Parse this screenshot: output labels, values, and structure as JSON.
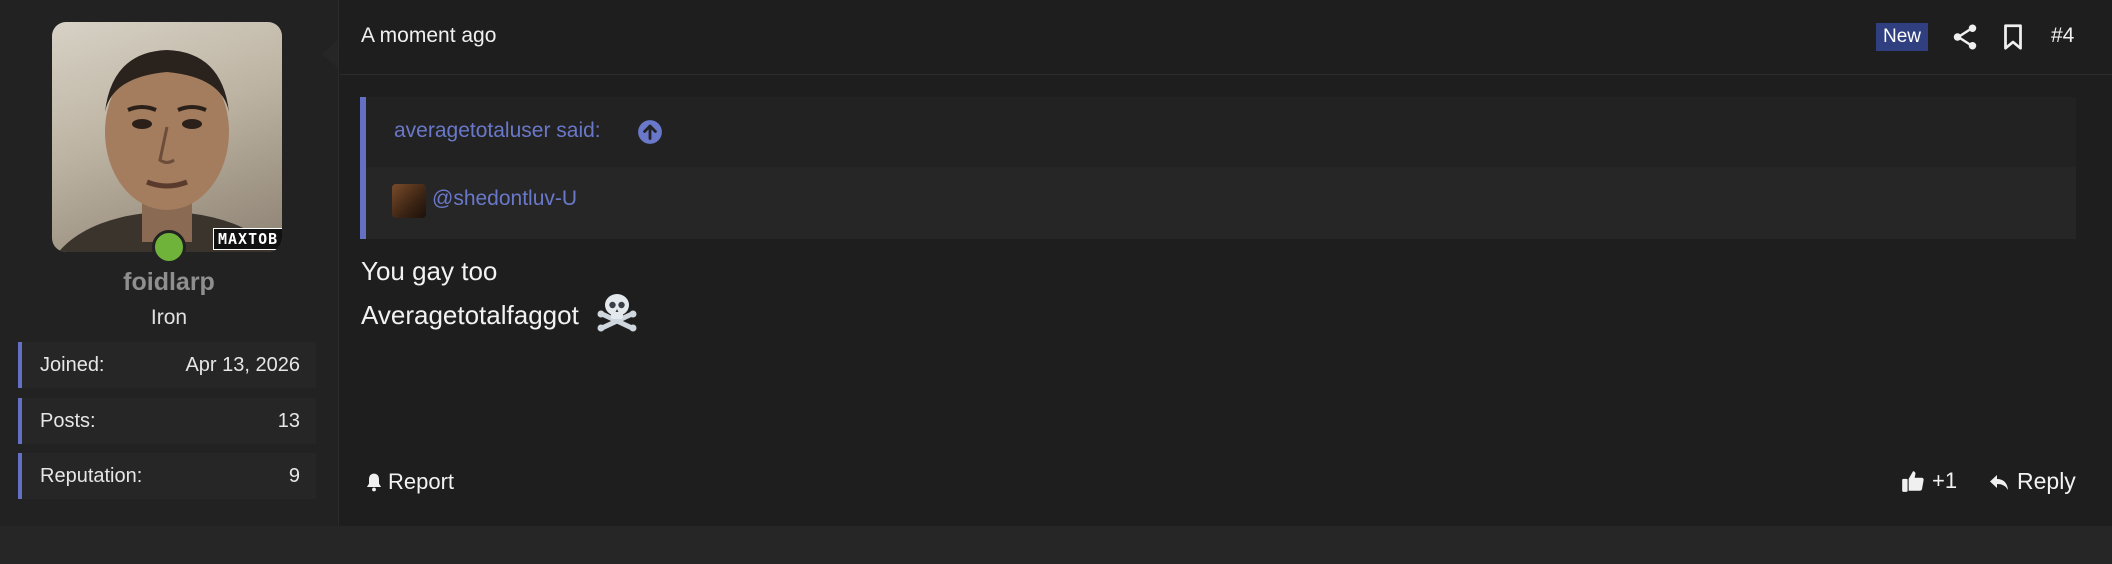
{
  "user": {
    "name": "foidlarp",
    "rank": "Iron",
    "avatar_badge": "MAXTOB",
    "status": "online",
    "stats": [
      {
        "label": "Joined:",
        "value": "Apr 13, 2026"
      },
      {
        "label": "Posts:",
        "value": "13"
      },
      {
        "label": "Reputation:",
        "value": "9"
      }
    ]
  },
  "post": {
    "timestamp": "A moment ago",
    "new_badge": "New",
    "number": "#4",
    "quote": {
      "author_line": "averagetotaluser said:",
      "mention": "@shedontluv-U"
    },
    "message_lines": [
      "You gay too",
      "Averagetotalfaggot"
    ],
    "emoji": "skull-and-crossbones",
    "actions": {
      "report": "Report",
      "like_count": "+1",
      "reply": "Reply"
    }
  },
  "colors": {
    "accent": "#6470c3",
    "link": "#6a78c9",
    "new_badge_bg": "#2f3f7f",
    "online": "#6fb33b",
    "background": "#1e1e1e"
  },
  "icons": [
    "share-icon",
    "bookmark-icon",
    "arrow-up-circle-icon",
    "bell-icon",
    "thumbs-up-icon",
    "reply-icon",
    "skull-crossbones-icon"
  ]
}
